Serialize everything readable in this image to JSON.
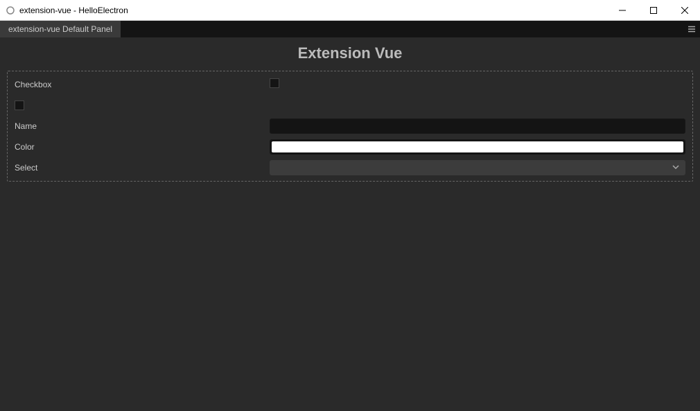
{
  "window": {
    "title": "extension-vue - HelloElectron"
  },
  "tabs": {
    "active": "extension-vue Default Panel"
  },
  "panel": {
    "title": "Extension Vue",
    "fields": {
      "checkbox": {
        "label": "Checkbox",
        "checked": false
      },
      "secondary_checkbox": {
        "checked": false
      },
      "name": {
        "label": "Name",
        "value": ""
      },
      "color": {
        "label": "Color",
        "value": "#ffffff"
      },
      "select": {
        "label": "Select",
        "value": ""
      }
    }
  }
}
